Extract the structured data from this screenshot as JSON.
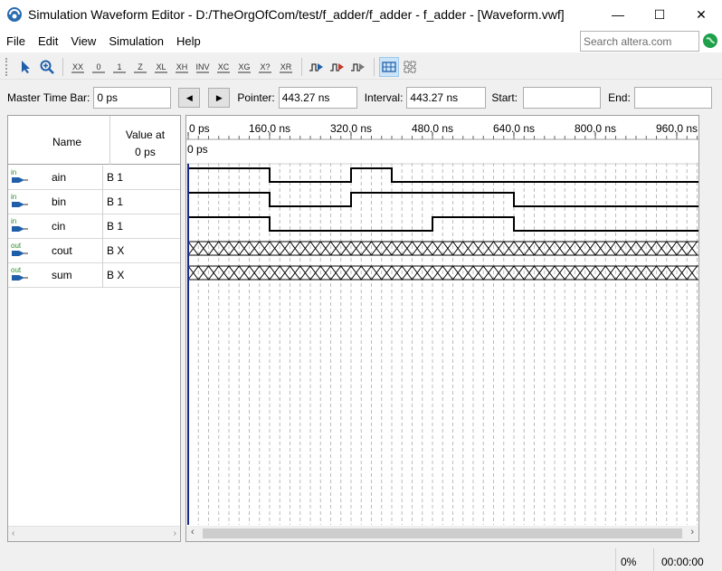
{
  "window": {
    "title": "Simulation Waveform Editor - D:/TheOrgOfCom/test/f_adder/f_adder - f_adder - [Waveform.vwf]",
    "minimize": "—",
    "maximize": "☐",
    "close": "✕"
  },
  "menu": [
    "File",
    "Edit",
    "View",
    "Simulation",
    "Help"
  ],
  "search": {
    "placeholder": "Search altera.com"
  },
  "toolbar": {
    "icons": [
      "selection-tool-icon",
      "zoom-tool-icon",
      "force-unknown-icon",
      "force-low-icon",
      "force-high-icon",
      "force-high-impedance-icon",
      "force-weak-low-icon",
      "force-weak-high-icon",
      "invert-icon",
      "count-value-icon",
      "clock-icon",
      "random-values-icon",
      "arbitrary-value-icon",
      "run-functional-simulation-icon",
      "run-timing-simulation-icon",
      "generate-netlist-icon",
      "snap-to-grid-icon",
      "grid-icon"
    ],
    "labels": [
      "",
      "",
      "XX",
      "0",
      "1",
      "Z",
      "XL",
      "XH",
      "INV",
      "XC",
      "XG",
      "X?",
      "XR",
      "",
      "",
      "",
      "",
      ""
    ]
  },
  "timebar": {
    "master_label": "Master Time Bar:",
    "master_value": "0 ps",
    "prev": "◀",
    "next": "▶",
    "pointer_label": "Pointer:",
    "pointer_value": "443.27 ns",
    "interval_label": "Interval:",
    "interval_value": "443.27 ns",
    "start_label": "Start:",
    "start_value": "",
    "end_label": "End:",
    "end_value": ""
  },
  "table_header": {
    "name": "Name",
    "value_line1": "Value at",
    "value_line2": "0 ps"
  },
  "signals": [
    {
      "dir": "in",
      "name": "ain",
      "value": "B 1",
      "waveform": [
        1,
        1,
        0,
        0,
        1,
        0,
        0,
        0,
        0,
        0,
        0,
        0,
        0
      ]
    },
    {
      "dir": "in",
      "name": "bin",
      "value": "B 1",
      "waveform": [
        1,
        1,
        0,
        0,
        1,
        1,
        1,
        1,
        0,
        0,
        0,
        0,
        0
      ]
    },
    {
      "dir": "in",
      "name": "cin",
      "value": "B 1",
      "waveform": [
        1,
        1,
        0,
        0,
        0,
        0,
        1,
        1,
        0,
        0,
        0,
        0,
        0
      ]
    },
    {
      "dir": "out",
      "name": "cout",
      "value": "B X",
      "waveform": "X"
    },
    {
      "dir": "out",
      "name": "sum",
      "value": "B X",
      "waveform": "X"
    }
  ],
  "timeline": {
    "ticks": [
      "0 ps",
      "160.0 ns",
      "320.0 ns",
      "480.0 ns",
      "640.0 ns",
      "800.0 ns",
      "960.0 ns"
    ],
    "cursor_label": "0 ps"
  },
  "status": {
    "progress": "0%",
    "elapsed": "00:00:00"
  },
  "colors": {
    "waveform": "#000000",
    "grid": "#bcbcbc",
    "cursor": "#1a2a8a",
    "in_label": "#2a8a2a",
    "out_label": "#2a8a2a",
    "arrow": "#1f5faa"
  }
}
